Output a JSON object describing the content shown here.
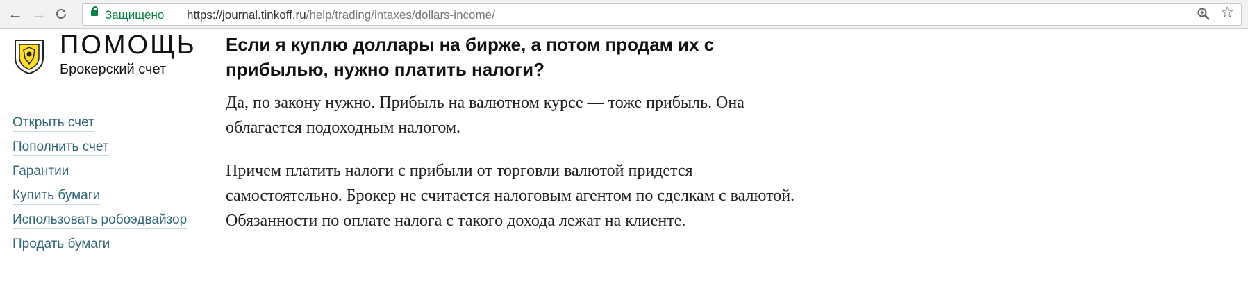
{
  "browser": {
    "back_icon": "arrow-left-icon",
    "forward_icon": "arrow-right-icon",
    "reload_icon": "reload-icon",
    "secure_label": "Защищено",
    "url_host": "https://journal.tinkoff.ru",
    "url_path": "/help/trading/intaxes/dollars-income/",
    "zoom_icon": "zoom-icon",
    "bookmark_icon": "star-icon"
  },
  "site": {
    "title": "ПОМОЩЬ",
    "subtitle": "Брокерский счет",
    "logo_icon": "tinkoff-shield-logo"
  },
  "sidebar": {
    "items": [
      {
        "label": "Открыть счет"
      },
      {
        "label": "Пополнить счет"
      },
      {
        "label": "Гарантии"
      },
      {
        "label": "Купить бумаги"
      },
      {
        "label": "Использовать робоэдвайзор"
      },
      {
        "label": "Продать бумаги"
      }
    ]
  },
  "article": {
    "title": "Если я куплю доллары на бирже, а потом продам их с прибылью, нужно платить налоги?",
    "paragraphs": [
      "Да, по закону нужно. Прибыль на валютном курсе — тоже прибыль. Она облагается подоходным налогом.",
      "Причем платить налоги с прибыли от торговли валютой придется самостоятельно. Брокер не считается налоговым агентом по сделкам с валютой. Обязанности по оплате налога с такого дохода лежат на клиенте."
    ]
  },
  "colors": {
    "secure_green": "#0b8043",
    "link": "#336677",
    "logo_yellow": "#ffdd2d"
  }
}
